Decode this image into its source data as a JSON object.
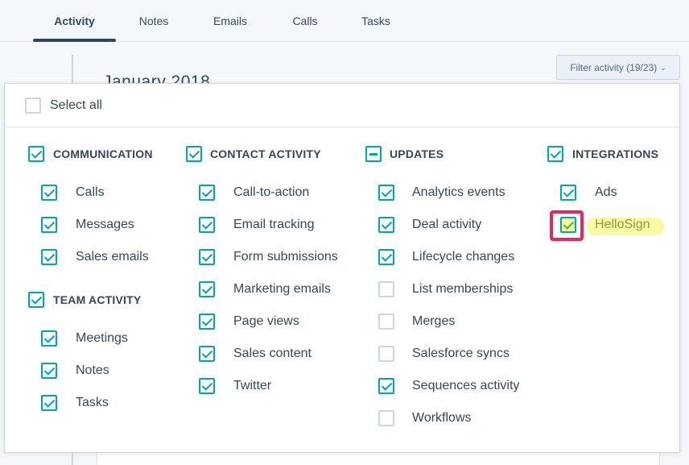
{
  "tabs": [
    {
      "label": "Activity",
      "active": true
    },
    {
      "label": "Notes",
      "active": false
    },
    {
      "label": "Emails",
      "active": false
    },
    {
      "label": "Calls",
      "active": false
    },
    {
      "label": "Tasks",
      "active": false
    }
  ],
  "timeline": {
    "month_heading": "January 2018"
  },
  "filter_button": {
    "label": "Filter activity (19/23)",
    "chevron": "⌄"
  },
  "select_all": {
    "label": "Select all",
    "checked": false
  },
  "groups": {
    "communication": {
      "label": "COMMUNICATION",
      "state": "checked",
      "items": [
        {
          "label": "Calls",
          "checked": true
        },
        {
          "label": "Messages",
          "checked": true
        },
        {
          "label": "Sales emails",
          "checked": true
        }
      ]
    },
    "team_activity": {
      "label": "TEAM ACTIVITY",
      "state": "checked",
      "items": [
        {
          "label": "Meetings",
          "checked": true
        },
        {
          "label": "Notes",
          "checked": true
        },
        {
          "label": "Tasks",
          "checked": true
        }
      ]
    },
    "contact_activity": {
      "label": "CONTACT ACTIVITY",
      "state": "checked",
      "items": [
        {
          "label": "Call-to-action",
          "checked": true
        },
        {
          "label": "Email tracking",
          "checked": true
        },
        {
          "label": "Form submissions",
          "checked": true
        },
        {
          "label": "Marketing emails",
          "checked": true
        },
        {
          "label": "Page views",
          "checked": true
        },
        {
          "label": "Sales content",
          "checked": true
        },
        {
          "label": "Twitter",
          "checked": true
        }
      ]
    },
    "updates": {
      "label": "UPDATES",
      "state": "partial",
      "items": [
        {
          "label": "Analytics events",
          "checked": true
        },
        {
          "label": "Deal activity",
          "checked": true
        },
        {
          "label": "Lifecycle changes",
          "checked": true
        },
        {
          "label": "List memberships",
          "checked": false
        },
        {
          "label": "Merges",
          "checked": false
        },
        {
          "label": "Salesforce syncs",
          "checked": false
        },
        {
          "label": "Sequences activity",
          "checked": true
        },
        {
          "label": "Workflows",
          "checked": false
        }
      ]
    },
    "integrations": {
      "label": "INTEGRATIONS",
      "state": "checked",
      "items": [
        {
          "label": "Ads",
          "checked": true
        },
        {
          "label": "HelloSign",
          "checked": true,
          "highlighted": true
        }
      ]
    }
  },
  "colors": {
    "accent": "#00a4bd",
    "text": "#33475b",
    "highlight": "#fbf99a",
    "annotation_red": "#e8265e"
  }
}
